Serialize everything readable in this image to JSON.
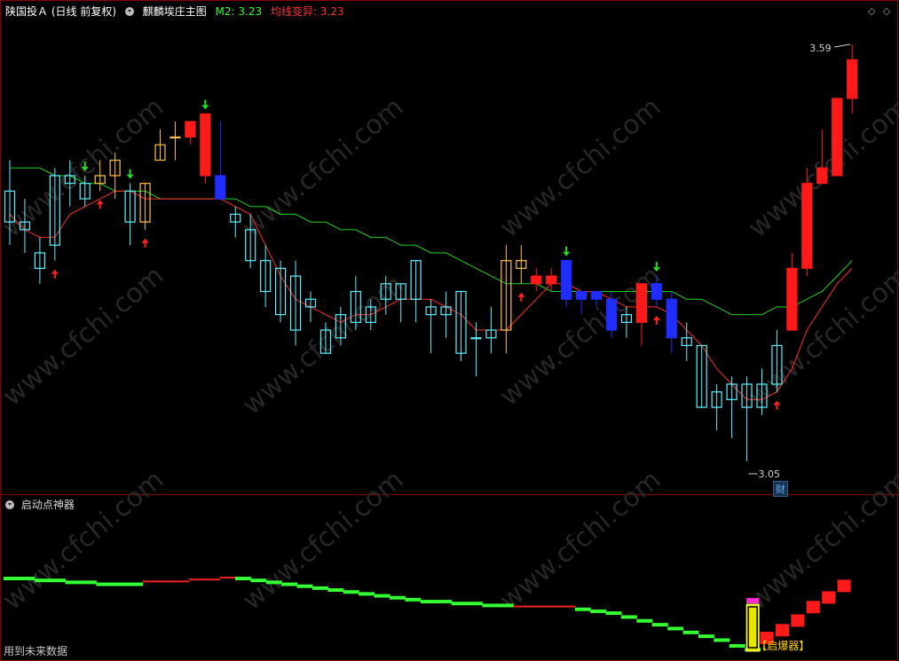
{
  "header": {
    "stock": "陕国投Ａ",
    "period": "(日线 前复权)",
    "indicator": "麒麟埃庄主图",
    "m2_label": "M2: 3.23",
    "avg_label": "均线变异: 3.23"
  },
  "sub_header": {
    "title": "启动点神器"
  },
  "footer": {
    "text": "用到未来数据"
  },
  "marks": {
    "cai": "财",
    "qibaoqi": "【启爆器】"
  },
  "colors": {
    "up_red": "#ff1a1a",
    "down_cyan": "#5ff0ff",
    "blue_fill": "#1f2dff",
    "gold": "#ffc04a",
    "green_line": "#1fd11f",
    "red_line": "#ff2b2b",
    "green_bar": "#33ff33",
    "red_bar": "#ff1a1a"
  },
  "chart_data": [
    {
      "type": "candlestick",
      "title": "麒麟埃庄主图",
      "annotations": [
        {
          "text": "3.59",
          "kind": "high"
        },
        {
          "text": "3.05",
          "kind": "low"
        }
      ],
      "candles": [
        {
          "open": 3.4,
          "close": 3.36,
          "high": 3.44,
          "low": 3.33,
          "style": "cyan"
        },
        {
          "open": 3.36,
          "close": 3.35,
          "high": 3.39,
          "low": 3.32,
          "style": "cyan"
        },
        {
          "open": 3.32,
          "close": 3.3,
          "high": 3.34,
          "low": 3.28,
          "style": "cyan"
        },
        {
          "open": 3.33,
          "close": 3.42,
          "high": 3.43,
          "low": 3.31,
          "style": "cyan"
        },
        {
          "open": 3.41,
          "close": 3.42,
          "high": 3.44,
          "low": 3.38,
          "style": "cyan"
        },
        {
          "open": 3.39,
          "close": 3.41,
          "high": 3.42,
          "low": 3.38,
          "style": "cyan"
        },
        {
          "open": 3.41,
          "close": 3.42,
          "high": 3.44,
          "low": 3.4,
          "style": "gold"
        },
        {
          "open": 3.42,
          "close": 3.44,
          "high": 3.45,
          "low": 3.39,
          "style": "gold"
        },
        {
          "open": 3.36,
          "close": 3.4,
          "high": 3.41,
          "low": 3.33,
          "style": "cyan"
        },
        {
          "open": 3.36,
          "close": 3.41,
          "high": 3.41,
          "low": 3.35,
          "style": "gold"
        },
        {
          "open": 3.44,
          "close": 3.46,
          "high": 3.48,
          "low": 3.44,
          "style": "gold"
        },
        {
          "open": 3.47,
          "close": 3.47,
          "high": 3.49,
          "low": 3.44,
          "style": "gold"
        },
        {
          "open": 3.49,
          "close": 3.47,
          "high": 3.49,
          "low": 3.46,
          "style": "red"
        },
        {
          "open": 3.42,
          "close": 3.5,
          "high": 3.5,
          "low": 3.41,
          "style": "red"
        },
        {
          "open": 3.42,
          "close": 3.39,
          "high": 3.49,
          "low": 3.39,
          "style": "blue"
        },
        {
          "open": 3.37,
          "close": 3.36,
          "high": 3.38,
          "low": 3.34,
          "style": "cyan"
        },
        {
          "open": 3.35,
          "close": 3.31,
          "high": 3.37,
          "low": 3.3,
          "style": "cyan"
        },
        {
          "open": 3.31,
          "close": 3.27,
          "high": 3.33,
          "low": 3.25,
          "style": "cyan"
        },
        {
          "open": 3.3,
          "close": 3.24,
          "high": 3.31,
          "low": 3.23,
          "style": "cyan"
        },
        {
          "open": 3.29,
          "close": 3.22,
          "high": 3.31,
          "low": 3.2,
          "style": "cyan"
        },
        {
          "open": 3.26,
          "close": 3.25,
          "high": 3.27,
          "low": 3.23,
          "style": "cyan"
        },
        {
          "open": 3.22,
          "close": 3.19,
          "high": 3.23,
          "low": 3.19,
          "style": "cyan"
        },
        {
          "open": 3.24,
          "close": 3.21,
          "high": 3.25,
          "low": 3.2,
          "style": "cyan"
        },
        {
          "open": 3.27,
          "close": 3.23,
          "high": 3.29,
          "low": 3.22,
          "style": "cyan"
        },
        {
          "open": 3.25,
          "close": 3.23,
          "high": 3.26,
          "low": 3.22,
          "style": "cyan"
        },
        {
          "open": 3.28,
          "close": 3.26,
          "high": 3.29,
          "low": 3.24,
          "style": "cyan"
        },
        {
          "open": 3.28,
          "close": 3.26,
          "high": 3.28,
          "low": 3.23,
          "style": "cyan"
        },
        {
          "open": 3.31,
          "close": 3.26,
          "high": 3.31,
          "low": 3.23,
          "style": "cyan"
        },
        {
          "open": 3.25,
          "close": 3.24,
          "high": 3.26,
          "low": 3.19,
          "style": "cyan"
        },
        {
          "open": 3.25,
          "close": 3.24,
          "high": 3.27,
          "low": 3.21,
          "style": "cyan"
        },
        {
          "open": 3.27,
          "close": 3.19,
          "high": 3.27,
          "low": 3.18,
          "style": "cyan"
        },
        {
          "open": 3.21,
          "close": 3.21,
          "high": 3.23,
          "low": 3.16,
          "style": "cyan"
        },
        {
          "open": 3.22,
          "close": 3.21,
          "high": 3.25,
          "low": 3.19,
          "style": "cyan"
        },
        {
          "open": 3.31,
          "close": 3.22,
          "high": 3.33,
          "low": 3.19,
          "style": "gold"
        },
        {
          "open": 3.31,
          "close": 3.3,
          "high": 3.33,
          "low": 3.28,
          "style": "gold"
        },
        {
          "open": 3.29,
          "close": 3.28,
          "high": 3.3,
          "low": 3.27,
          "style": "red"
        },
        {
          "open": 3.29,
          "close": 3.28,
          "high": 3.3,
          "low": 3.27,
          "style": "red"
        },
        {
          "open": 3.31,
          "close": 3.26,
          "high": 3.31,
          "low": 3.25,
          "style": "blue"
        },
        {
          "open": 3.27,
          "close": 3.26,
          "high": 3.27,
          "low": 3.24,
          "style": "blue"
        },
        {
          "open": 3.27,
          "close": 3.26,
          "high": 3.27,
          "low": 3.25,
          "style": "blue"
        },
        {
          "open": 3.26,
          "close": 3.22,
          "high": 3.27,
          "low": 3.21,
          "style": "blue"
        },
        {
          "open": 3.24,
          "close": 3.23,
          "high": 3.25,
          "low": 3.21,
          "style": "cyan"
        },
        {
          "open": 3.23,
          "close": 3.28,
          "high": 3.28,
          "low": 3.2,
          "style": "red"
        },
        {
          "open": 3.28,
          "close": 3.26,
          "high": 3.29,
          "low": 3.25,
          "style": "blue"
        },
        {
          "open": 3.26,
          "close": 3.21,
          "high": 3.27,
          "low": 3.19,
          "style": "blue"
        },
        {
          "open": 3.21,
          "close": 3.2,
          "high": 3.23,
          "low": 3.18,
          "style": "cyan"
        },
        {
          "open": 3.2,
          "close": 3.12,
          "high": 3.2,
          "low": 3.12,
          "style": "cyan"
        },
        {
          "open": 3.14,
          "close": 3.12,
          "high": 3.15,
          "low": 3.09,
          "style": "cyan"
        },
        {
          "open": 3.15,
          "close": 3.13,
          "high": 3.16,
          "low": 3.08,
          "style": "cyan"
        },
        {
          "open": 3.15,
          "close": 3.12,
          "high": 3.16,
          "low": 3.05,
          "style": "cyan"
        },
        {
          "open": 3.12,
          "close": 3.15,
          "high": 3.17,
          "low": 3.11,
          "style": "cyan"
        },
        {
          "open": 3.15,
          "close": 3.2,
          "high": 3.22,
          "low": 3.14,
          "style": "cyan"
        },
        {
          "open": 3.22,
          "close": 3.3,
          "high": 3.32,
          "low": 3.22,
          "style": "red"
        },
        {
          "open": 3.3,
          "close": 3.41,
          "high": 3.43,
          "low": 3.29,
          "style": "red"
        },
        {
          "open": 3.41,
          "close": 3.43,
          "high": 3.48,
          "low": 3.41,
          "style": "red"
        },
        {
          "open": 3.42,
          "close": 3.52,
          "high": 3.52,
          "low": 3.42,
          "style": "red"
        },
        {
          "open": 3.52,
          "close": 3.57,
          "high": 3.59,
          "low": 3.5,
          "style": "red"
        }
      ],
      "ma_green": [
        3.43,
        3.43,
        3.43,
        3.42,
        3.42,
        3.41,
        3.41,
        3.4,
        3.4,
        3.4,
        3.39,
        3.39,
        3.39,
        3.39,
        3.39,
        3.39,
        3.38,
        3.38,
        3.37,
        3.37,
        3.36,
        3.36,
        3.35,
        3.35,
        3.34,
        3.34,
        3.33,
        3.33,
        3.32,
        3.32,
        3.31,
        3.3,
        3.29,
        3.28,
        3.28,
        3.28,
        3.27,
        3.27,
        3.27,
        3.27,
        3.27,
        3.27,
        3.27,
        3.27,
        3.27,
        3.26,
        3.26,
        3.25,
        3.24,
        3.24,
        3.24,
        3.25,
        3.25,
        3.26,
        3.27,
        3.29,
        3.31
      ],
      "ma_red": [
        3.37,
        3.35,
        3.34,
        3.34,
        3.37,
        3.38,
        3.39,
        3.4,
        3.4,
        3.39,
        3.39,
        3.39,
        3.39,
        3.39,
        3.39,
        3.38,
        3.37,
        3.33,
        3.29,
        3.26,
        3.25,
        3.24,
        3.23,
        3.24,
        3.24,
        3.25,
        3.26,
        3.26,
        3.26,
        3.25,
        3.24,
        3.22,
        3.22,
        3.22,
        3.24,
        3.26,
        3.28,
        3.28,
        3.27,
        3.27,
        3.26,
        3.25,
        3.25,
        3.25,
        3.24,
        3.22,
        3.2,
        3.17,
        3.15,
        3.13,
        3.13,
        3.14,
        3.17,
        3.22,
        3.25,
        3.28,
        3.3
      ],
      "arrows_up": [
        3,
        6,
        9,
        34,
        43,
        51
      ],
      "arrows_down": [
        5,
        8,
        13,
        37,
        43
      ]
    },
    {
      "type": "bar",
      "title": "启动点神器",
      "values": [
        0.92,
        0.92,
        0.91,
        0.91,
        0.9,
        0.9,
        0.89,
        0.89,
        0.89,
        0.9,
        0.9,
        0.9,
        0.91,
        0.91,
        0.92,
        0.92,
        0.91,
        0.9,
        0.89,
        0.88,
        0.87,
        0.86,
        0.85,
        0.84,
        0.83,
        0.82,
        0.81,
        0.8,
        0.8,
        0.79,
        0.79,
        0.78,
        0.78,
        0.77,
        0.77,
        0.77,
        0.77,
        0.76,
        0.75,
        0.74,
        0.72,
        0.7,
        0.68,
        0.66,
        0.64,
        0.62,
        0.6,
        0.57,
        0.55,
        0.57,
        0.61,
        0.66,
        0.73,
        0.78,
        0.84
      ],
      "colors": [
        "green",
        "green",
        "green",
        "green",
        "green",
        "green",
        "green",
        "green",
        "green",
        "red",
        "red",
        "red",
        "red",
        "red",
        "red",
        "green",
        "green",
        "green",
        "green",
        "green",
        "green",
        "green",
        "green",
        "green",
        "green",
        "green",
        "green",
        "green",
        "green",
        "green",
        "green",
        "green",
        "green",
        "red",
        "red",
        "red",
        "red",
        "green",
        "green",
        "green",
        "green",
        "green",
        "green",
        "green",
        "green",
        "green",
        "green",
        "green",
        "green",
        "red",
        "red",
        "red",
        "red",
        "red",
        "red"
      ],
      "special_bar_index": 49
    }
  ]
}
